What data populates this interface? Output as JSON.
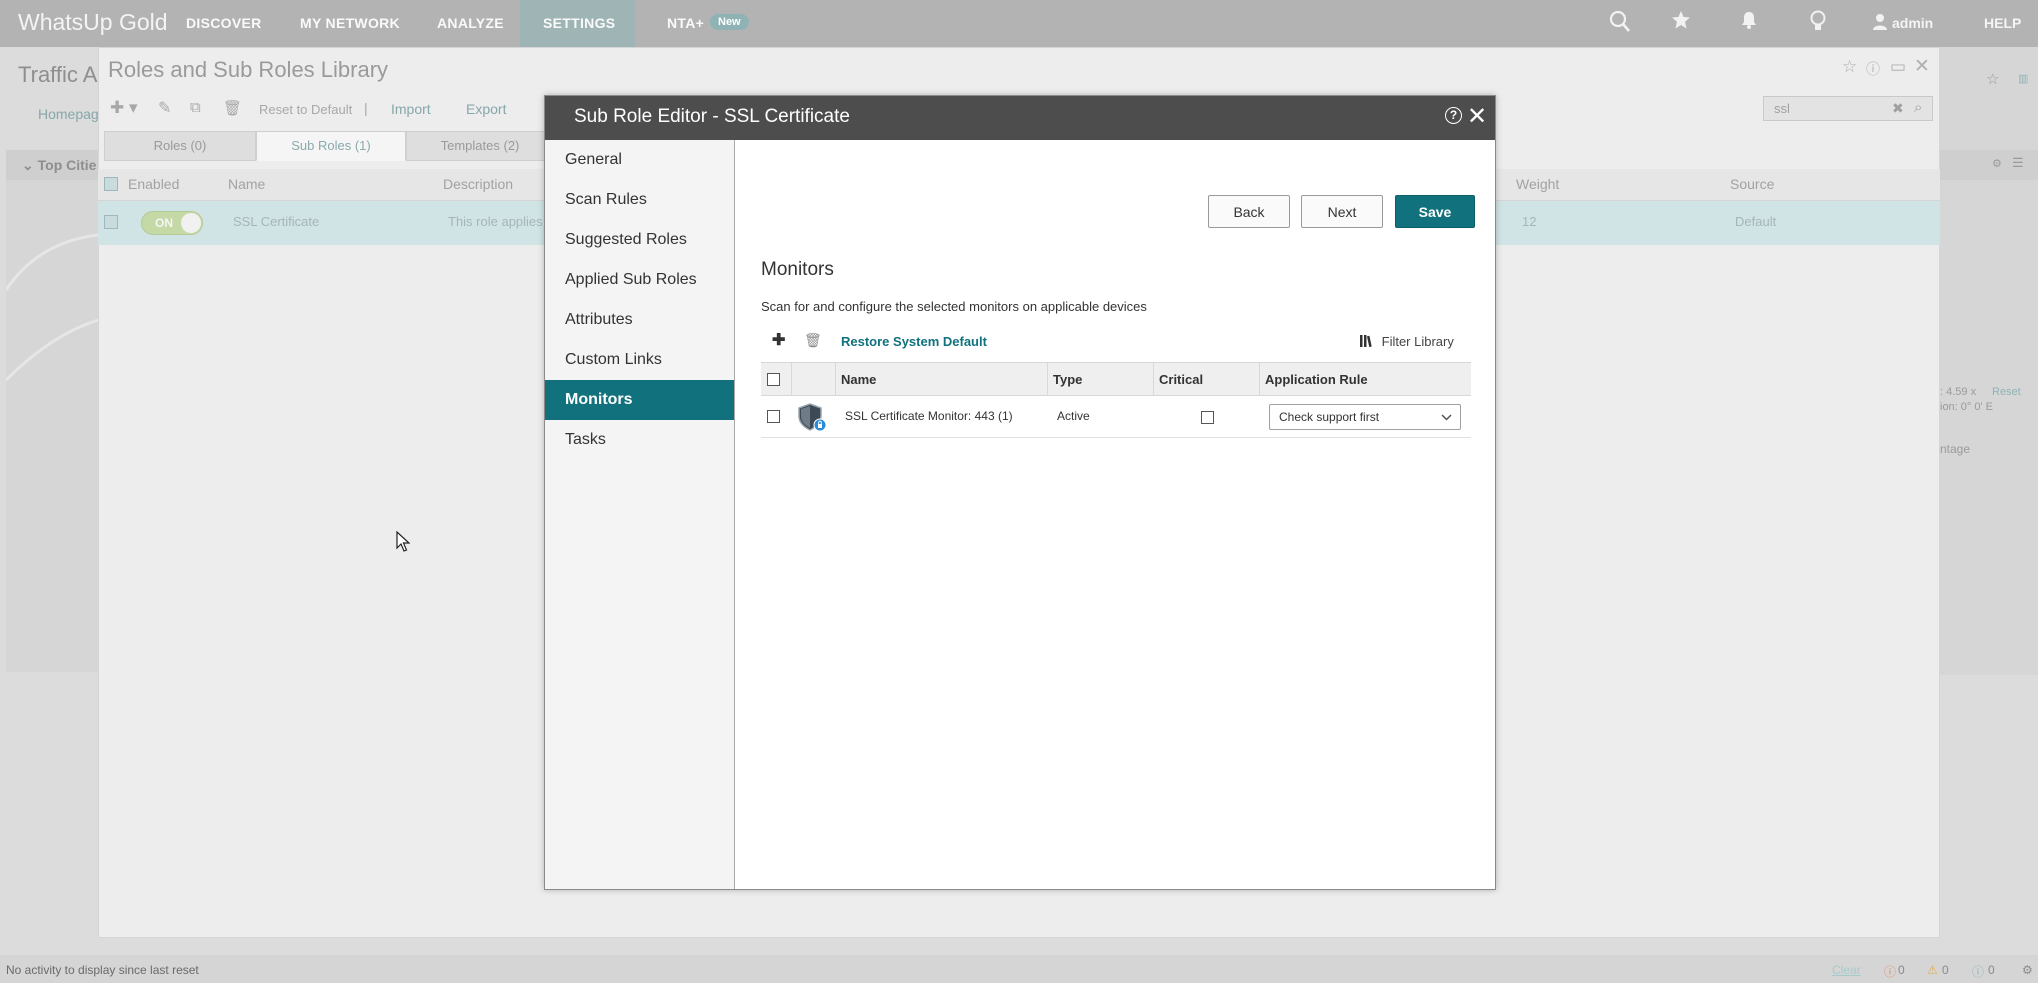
{
  "topnav": {
    "brand": "WhatsUp Gold",
    "items": [
      "DISCOVER",
      "MY NETWORK",
      "ANALYZE",
      "SETTINGS",
      "NTA+"
    ],
    "new_badge": "New",
    "user": "admin",
    "help": "HELP",
    "icons": [
      "search-icon",
      "star-icon",
      "bell-icon",
      "lightbulb-icon",
      "user-icon"
    ]
  },
  "background": {
    "page_title": "Traffic Ar",
    "homepage_link": "Homepag",
    "top_cities": "Top Citie",
    "zoom_text": ": 4.59 x",
    "reset": "Reset",
    "location_text": "ion: 0° 0' E",
    "percentage_text": "ntage"
  },
  "library": {
    "title": "Roles and Sub Roles Library",
    "toolbar": {
      "reset_default": "Reset to Default",
      "import": "Import",
      "export": "Export"
    },
    "search_value": "ssl",
    "tabs": [
      "Roles (0)",
      "Sub Roles (1)",
      "Templates (2)"
    ],
    "columns": [
      "Enabled",
      "Name",
      "Description",
      "Weight",
      "Source"
    ],
    "row": {
      "toggle": "ON",
      "name": "SSL Certificate",
      "description": "This role applies",
      "weight": "12",
      "source": "Default"
    }
  },
  "modal": {
    "title": "Sub Role Editor - SSL Certificate",
    "help_glyph": "?",
    "nav": [
      "General",
      "Scan Rules",
      "Suggested Roles",
      "Applied Sub Roles",
      "Attributes",
      "Custom Links",
      "Monitors",
      "Tasks"
    ],
    "active_nav": "Monitors",
    "buttons": {
      "back": "Back",
      "next": "Next",
      "save": "Save"
    },
    "section_title": "Monitors",
    "section_desc": "Scan for and configure the selected monitors on applicable devices",
    "restore_link": "Restore System Default",
    "filter_library": "Filter Library",
    "table": {
      "columns": [
        "Name",
        "Type",
        "Critical",
        "Application Rule"
      ],
      "rows": [
        {
          "name": "SSL Certificate Monitor: 443 (1)",
          "type": "Active",
          "critical": false,
          "application_rule": "Check support first"
        }
      ]
    }
  },
  "statusbar": {
    "message": "No activity to display since last reset",
    "clear": "Clear",
    "errors": "0",
    "warnings": "0",
    "info": "0"
  },
  "colors": {
    "accent": "#11727d",
    "modal_header": "#4d4d4d",
    "topnav_overlay": "#b3b3b3"
  }
}
